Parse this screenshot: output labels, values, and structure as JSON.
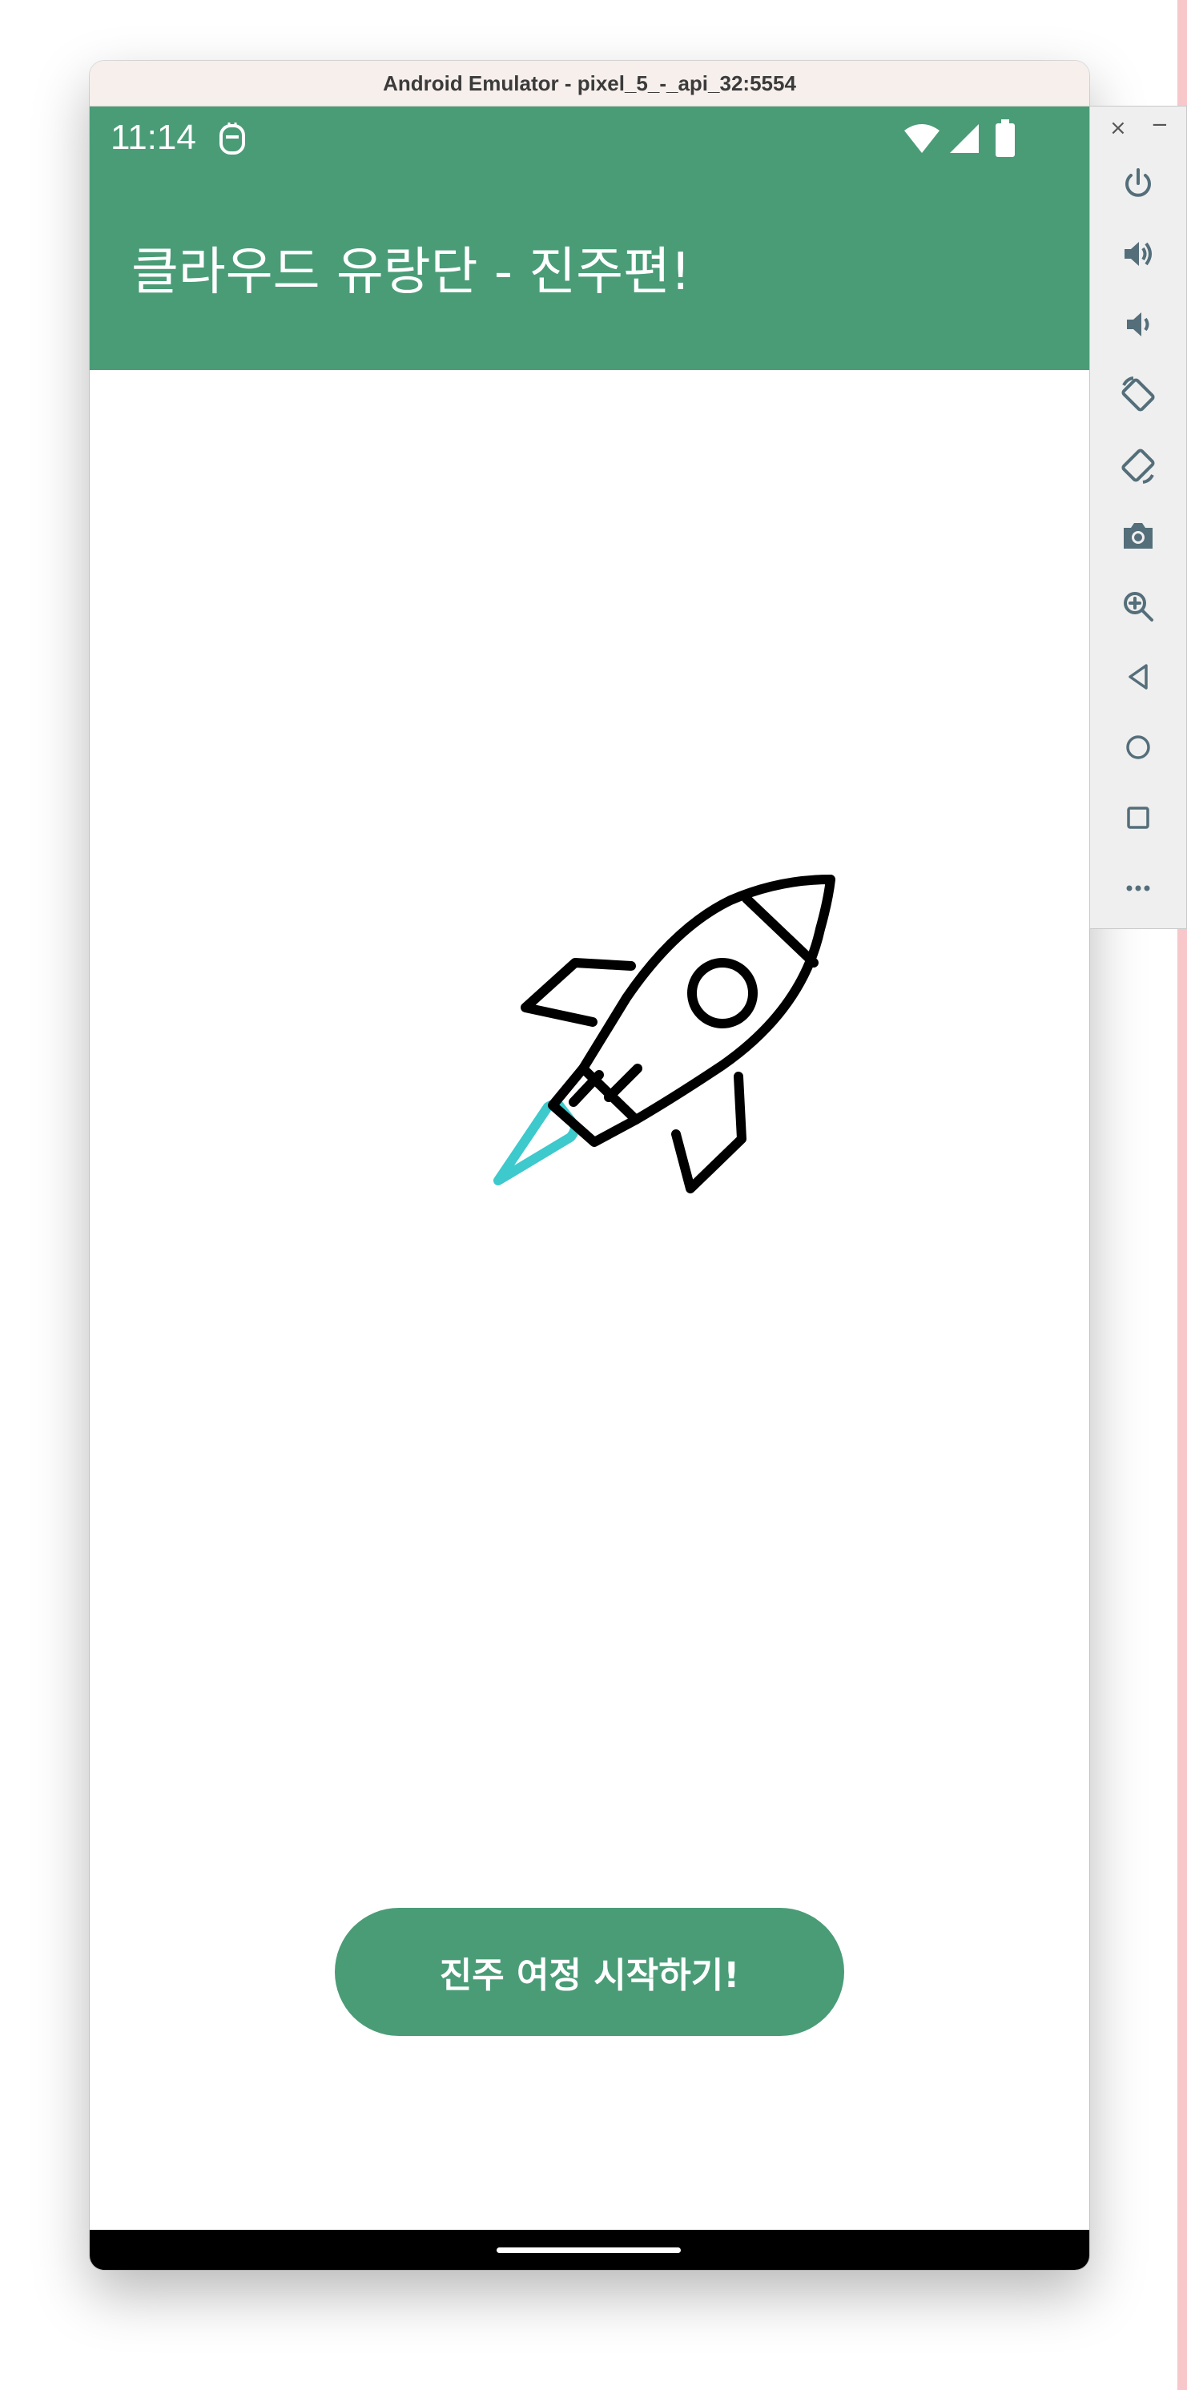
{
  "window": {
    "title": "Android Emulator - pixel_5_-_api_32:5554"
  },
  "statusbar": {
    "time": "11:14"
  },
  "appbar": {
    "title": "클라우드 유랑단 - 진주편!"
  },
  "main": {
    "start_button_label": "진주 여정 시작하기!"
  },
  "colors": {
    "primary": "#4a9c77",
    "rocket_flame": "#3ec9cc",
    "toolbar_icon": "#546e7a"
  },
  "toolbar": {
    "close_label": "×",
    "minimize_label": "−",
    "buttons": [
      "power-icon",
      "volume-up-icon",
      "volume-down-icon",
      "rotate-left-icon",
      "rotate-right-icon",
      "camera-icon",
      "zoom-icon",
      "back-icon",
      "home-icon",
      "overview-icon",
      "more-icon"
    ]
  }
}
